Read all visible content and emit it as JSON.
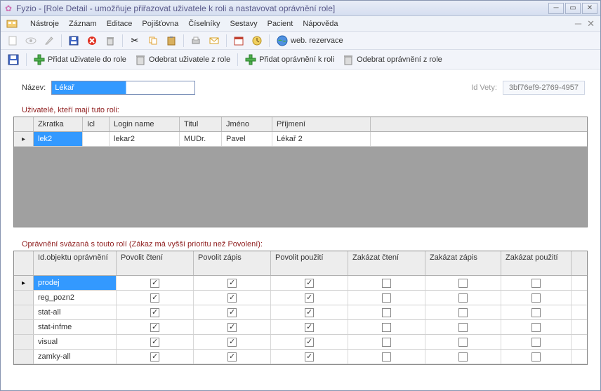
{
  "window": {
    "title": "Fyzio  -  [Role Detail - umožňuje přiřazovat uživatele k roli a nastavovat oprávnění role]"
  },
  "menu": {
    "items": [
      "Nástroje",
      "Záznam",
      "Editace",
      "Pojišťovna",
      "Číselníky",
      "Sestavy",
      "Pacient",
      "Nápověda"
    ]
  },
  "toolbar1": {
    "web_rez": "web. rezervace"
  },
  "toolbar2": {
    "save": "",
    "add_user": "Přidat uživatele do role",
    "remove_user": "Odebrat uživatele z role",
    "add_perm": "Přidat oprávnění k roli",
    "remove_perm": "Odebrat oprávnění z role"
  },
  "form": {
    "name_label": "Název:",
    "name_value": "Lékař",
    "idvety_label": "Id Vety:",
    "idvety_value": "3bf76ef9-2769-4957"
  },
  "users_section": {
    "title": "Uživatelé, kteří mají tuto roli:",
    "cols": {
      "zkratka": "Zkratka",
      "icl": "Icl",
      "login": "Login name",
      "titul": "Titul",
      "jmeno": "Jméno",
      "prijmeni": "Příjmení"
    },
    "rows": [
      {
        "zkratka": "lek2",
        "icl": "",
        "login": "lekar2",
        "titul": "MUDr.",
        "jmeno": "Pavel",
        "prijmeni": "Lékař 2"
      }
    ]
  },
  "perms_section": {
    "title": "Oprávnění svázaná s touto rolí (Zákaz má vyšší prioritu než Povolení):",
    "cols": {
      "idobj": "Id.objektu oprávnění",
      "pcteni": "Povolit čtení",
      "pzapis": "Povolit zápis",
      "ppouziti": "Povolit použití",
      "zcteni": "Zakázat čtení",
      "zzapis": "Zakázat zápis",
      "zpouziti": "Zakázat použití"
    },
    "rows": [
      {
        "id": "prodej",
        "pc": true,
        "pz": true,
        "pp": true,
        "zc": false,
        "zz": false,
        "zp": false
      },
      {
        "id": "reg_pozn2",
        "pc": true,
        "pz": true,
        "pp": true,
        "zc": false,
        "zz": false,
        "zp": false
      },
      {
        "id": "stat-all",
        "pc": true,
        "pz": true,
        "pp": true,
        "zc": false,
        "zz": false,
        "zp": false
      },
      {
        "id": "stat-infme",
        "pc": true,
        "pz": true,
        "pp": true,
        "zc": false,
        "zz": false,
        "zp": false
      },
      {
        "id": "visual",
        "pc": true,
        "pz": true,
        "pp": true,
        "zc": false,
        "zz": false,
        "zp": false
      },
      {
        "id": "zamky-all",
        "pc": true,
        "pz": true,
        "pp": true,
        "zc": false,
        "zz": false,
        "zp": false
      }
    ]
  },
  "col_widths": {
    "users": {
      "ind": 28,
      "zkratka": 70,
      "icl": 38,
      "login": 100,
      "titul": 60,
      "jmeno": 72,
      "prijmeni": 140
    },
    "perms": {
      "ind": 28,
      "idobj": 118,
      "pc": 110,
      "pz": 110,
      "pp": 110,
      "zc": 110,
      "zz": 108,
      "zp": 100
    }
  }
}
